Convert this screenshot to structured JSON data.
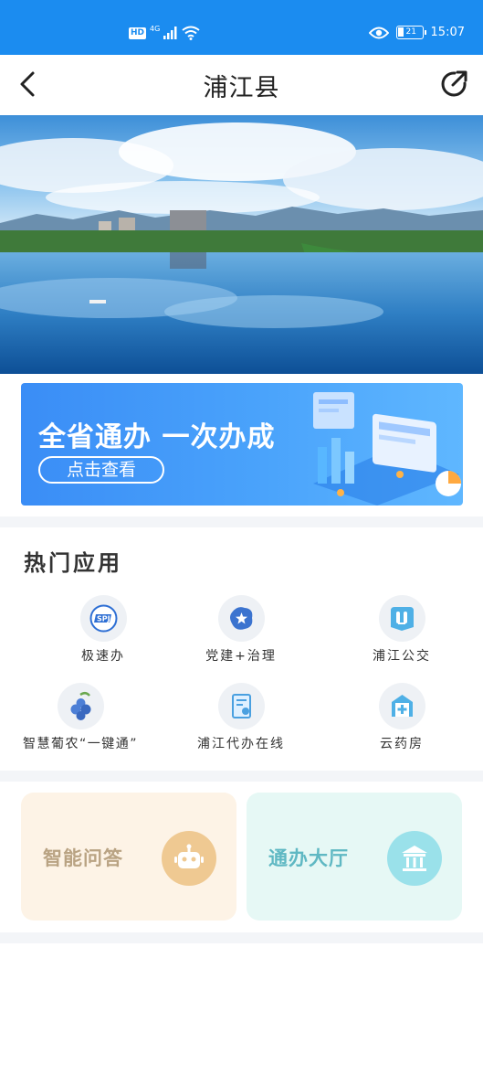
{
  "status_bar": {
    "hd": "HD",
    "network": "4G",
    "battery": "21",
    "time": "15:07"
  },
  "nav": {
    "title": "浦江县"
  },
  "promo": {
    "title": "全省通办 一次办成",
    "button": "点击查看"
  },
  "hot_apps": {
    "title": "热门应用",
    "items": [
      {
        "label": "极速办",
        "icon": "express-service-icon"
      },
      {
        "label": "党建+治理",
        "icon": "party-building-icon"
      },
      {
        "label": "浦江公交",
        "icon": "bus-icon"
      },
      {
        "label": "智慧葡农“一键通”",
        "icon": "grape-icon"
      },
      {
        "label": "浦江代办在线",
        "icon": "document-icon"
      },
      {
        "label": "云药房",
        "icon": "pharmacy-icon"
      }
    ]
  },
  "cards": {
    "ai": {
      "label": "智能问答",
      "icon": "robot-icon"
    },
    "hall": {
      "label": "通办大厅",
      "icon": "hall-building-icon"
    }
  },
  "colors": {
    "status_bar": "#1b8cf0",
    "promo_blue": "#3a8df6",
    "card_ai_bg": "#fdf3e6",
    "card_hall_bg": "#e6f8f5"
  }
}
